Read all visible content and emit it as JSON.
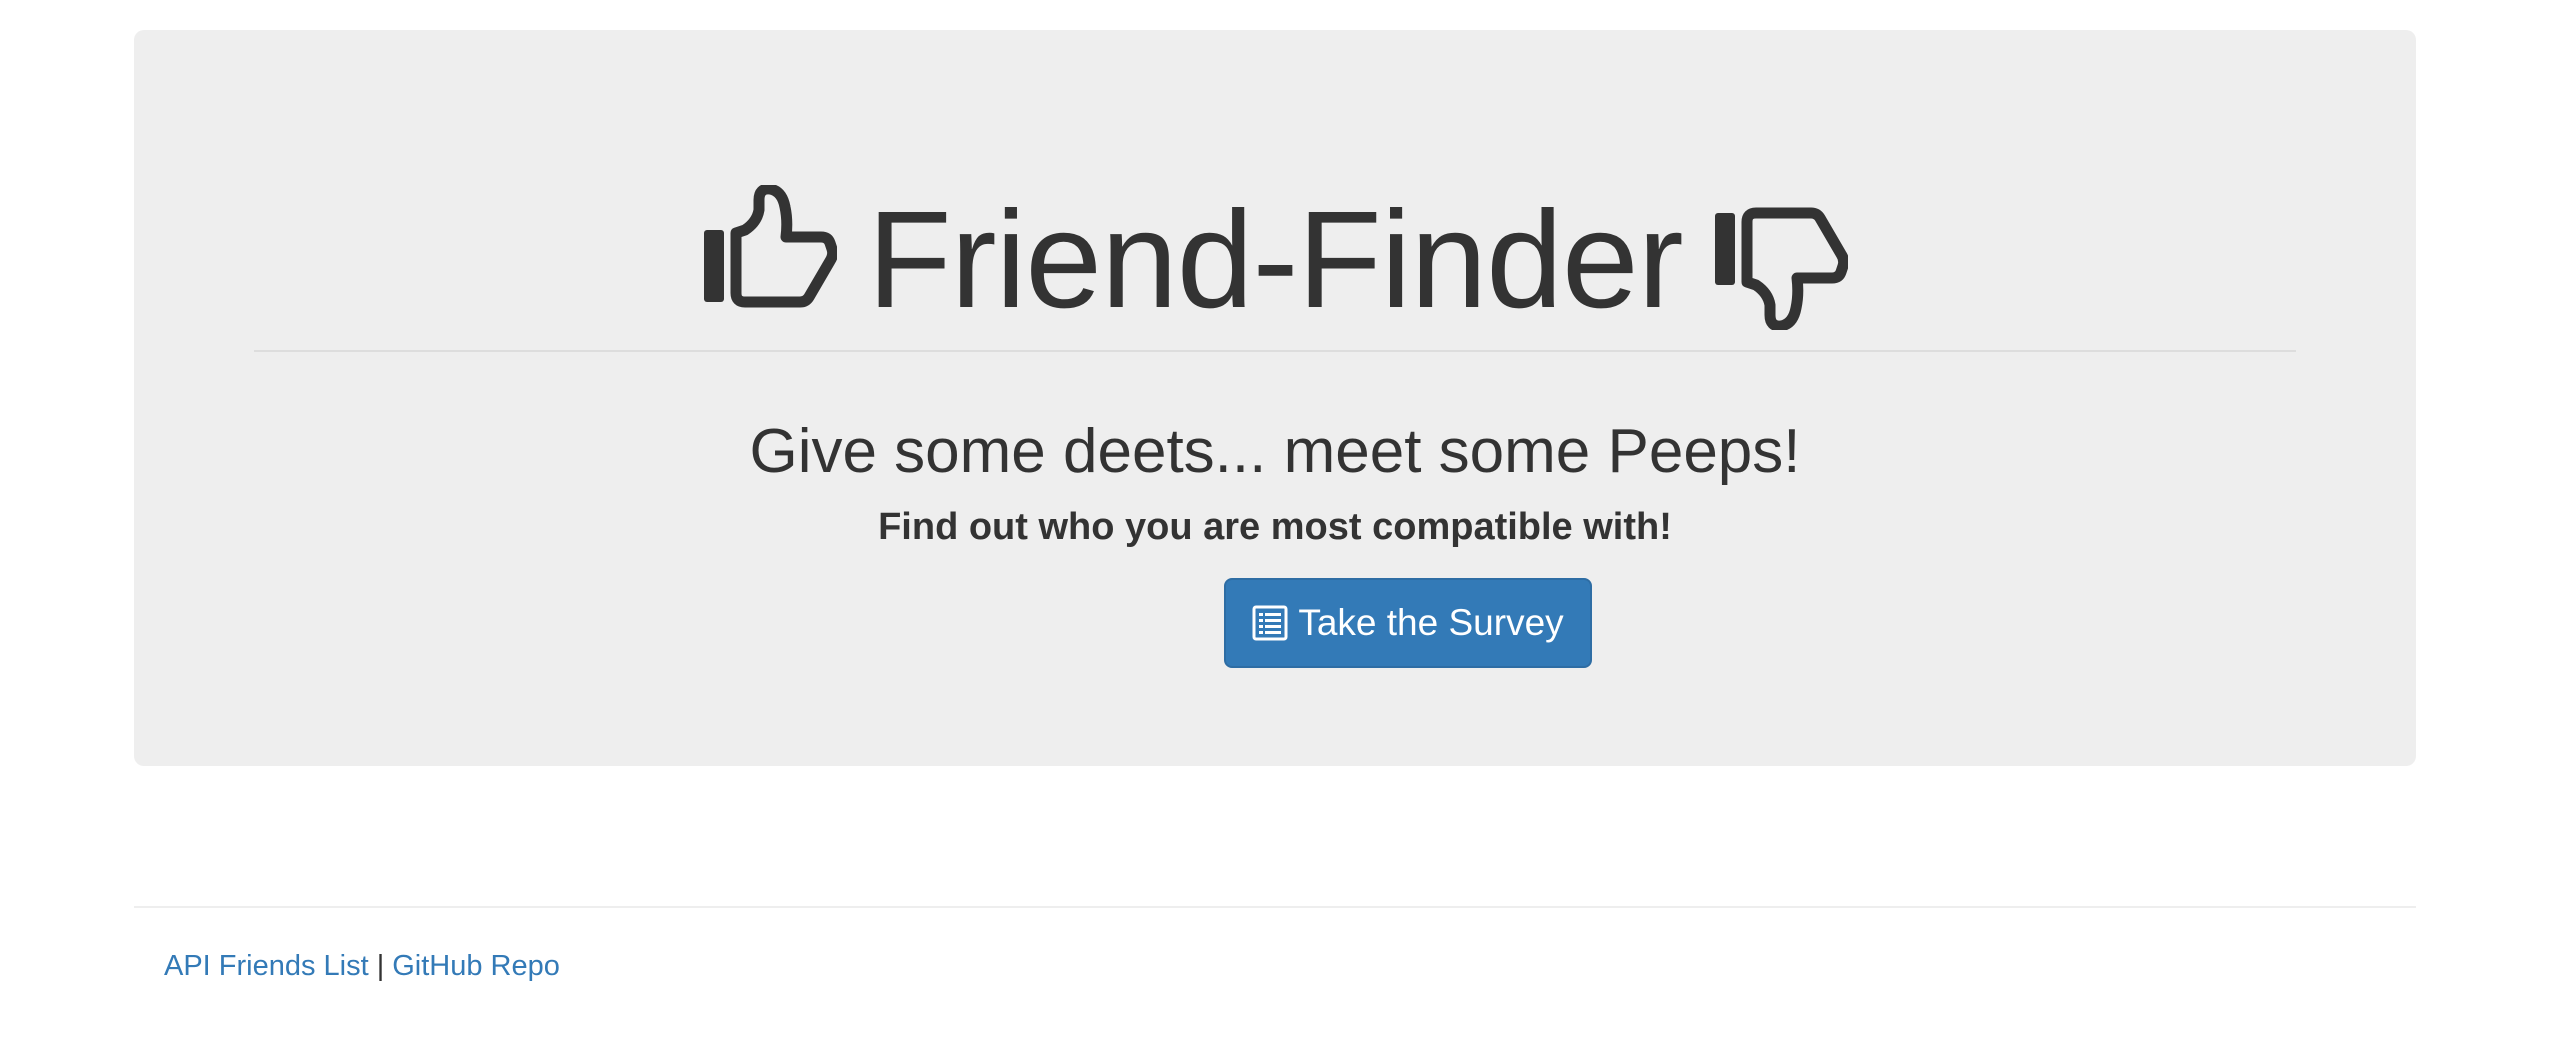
{
  "hero": {
    "title": "Friend-Finder",
    "subtitle": "Give some deets... meet some Peeps!",
    "tagline": "Find out who you are most compatible with!",
    "survey_button": {
      "label": "Take the Survey",
      "icon": "list-alt-icon"
    },
    "icons": {
      "left": "thumbs-up-icon",
      "right": "thumbs-down-icon"
    }
  },
  "footer": {
    "links": [
      {
        "label": "API Friends List"
      },
      {
        "label": "GitHub Repo"
      }
    ],
    "separator": "|"
  },
  "colors": {
    "jumbotron_bg": "#eeeeee",
    "primary": "#337ab7",
    "text": "#333333"
  }
}
